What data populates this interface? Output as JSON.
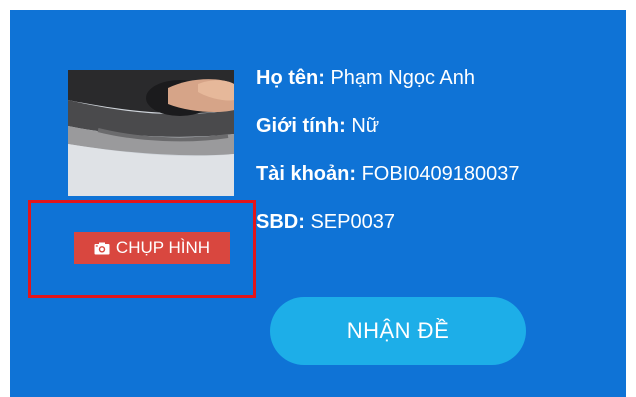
{
  "profile": {
    "capture_button_label": "CHỤP HÌNH",
    "capture_icon": "camera-icon",
    "fields": {
      "name": {
        "label": "Họ tên:",
        "value": "Phạm Ngọc Anh"
      },
      "gender": {
        "label": "Giới tính:",
        "value": "Nữ"
      },
      "account": {
        "label": "Tài khoản:",
        "value": "FOBI0409180037"
      },
      "sbd": {
        "label": "SBD:",
        "value": "SEP0037"
      }
    }
  },
  "actions": {
    "receive_exam_label": "NHẬN ĐỀ"
  },
  "colors": {
    "panel": "#0f73d6",
    "capture_button": "#d9473f",
    "highlight": "#e3151a",
    "receive_button": "#1daee8"
  }
}
